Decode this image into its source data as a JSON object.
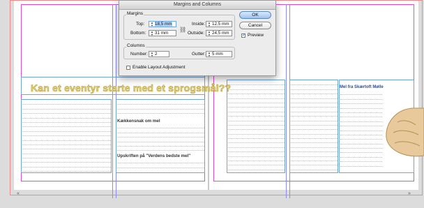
{
  "dialog": {
    "title": "Margins and Columns",
    "margins": {
      "group_label": "Margins",
      "top_label": "Top:",
      "top_value": "18,5 mm",
      "bottom_label": "Bottom:",
      "bottom_value": "31 mm",
      "inside_label": "Inside:",
      "inside_value": "12,5 mm",
      "outside_label": "Outside:",
      "outside_value": "24,5 mm"
    },
    "columns": {
      "group_label": "Columns",
      "number_label": "Number:",
      "number_value": "2",
      "gutter_label": "Gutter:",
      "gutter_value": "5 mm"
    },
    "ok_label": "OK",
    "cancel_label": "Cancel",
    "preview_label": "Preview",
    "preview_checked": true,
    "enable_layout_label": "Enable Layout Adjustment",
    "enable_layout_checked": false
  },
  "document": {
    "headline": "Kan et eventyr starte med et sprogsmål??",
    "sub_heading_1": "Kækkensnak om mel",
    "sub_heading_2": "Upskriften på \"Verdens bedste mel\"",
    "sidebar_title": "Mel fra Skærtoft Mølle",
    "page_nav_left": "«",
    "page_nav_right": "»"
  },
  "icons": {
    "chain": "chain-link-icon",
    "stepper": "stepper-arrows-icon",
    "check": "checkmark-icon"
  }
}
